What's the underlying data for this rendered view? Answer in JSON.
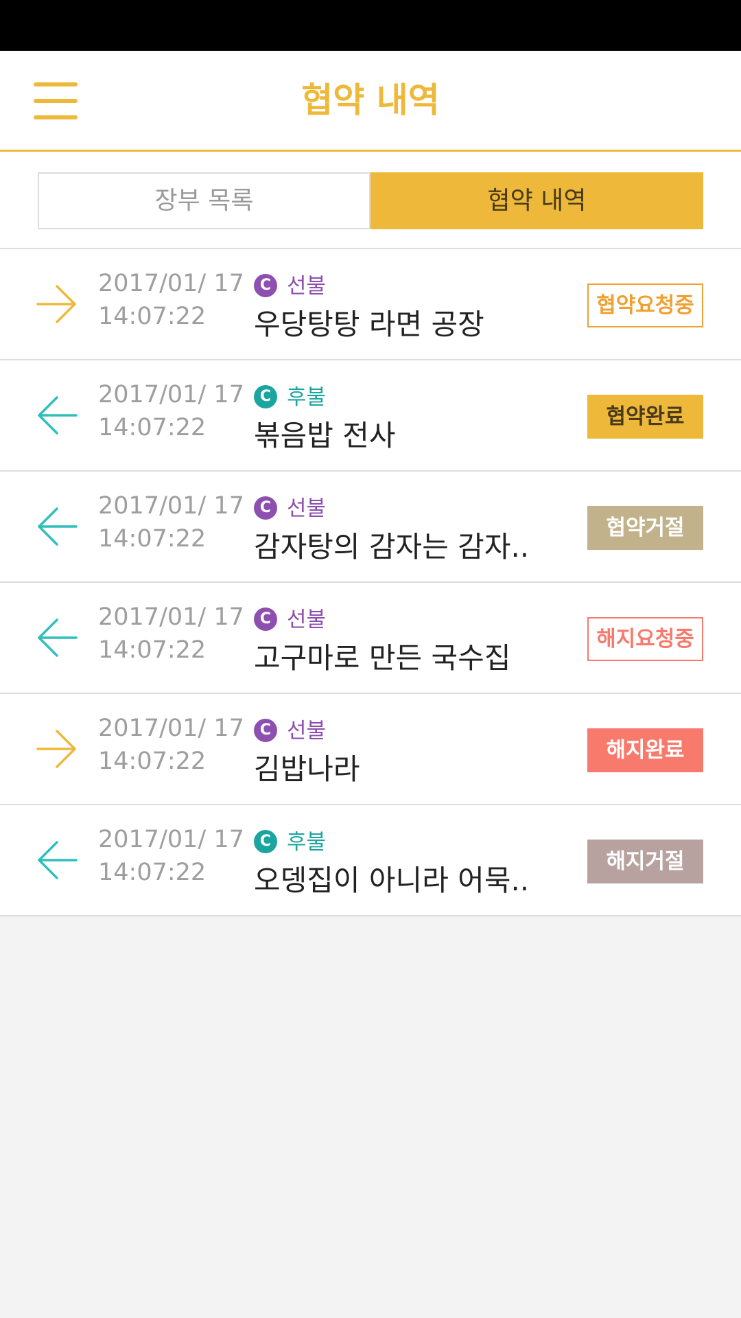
{
  "colors": {
    "accent": "#eeb93a",
    "prepaid": "#8d4fb0",
    "postpaid": "#1aa5a0",
    "outgoing_arrow": "#eeb93a",
    "incoming_arrow": "#2ebfbd"
  },
  "header": {
    "title": "협약 내역",
    "menu_icon": "hamburger-menu-icon"
  },
  "tabs": [
    {
      "label": "장부 목록",
      "active": false
    },
    {
      "label": "협약 내역",
      "active": true
    }
  ],
  "contracts": [
    {
      "direction": "outgoing",
      "icon": "arrow-right-icon",
      "date": "2017/01/ 17",
      "time": "14:07:22",
      "payment_type": "prepaid",
      "pay_badge": "C",
      "payment_label": "선불",
      "name": "우당탕탕 라면 공장",
      "status": "협약요청중",
      "status_style": {
        "bg": "#ffffff",
        "border": "#f0a030",
        "color": "#f0a030"
      }
    },
    {
      "direction": "incoming",
      "icon": "arrow-left-icon",
      "date": "2017/01/ 17",
      "time": "14:07:22",
      "payment_type": "postpaid",
      "pay_badge": "C",
      "payment_label": "후불",
      "name": "볶음밥 전사",
      "status": "협약완료",
      "status_style": {
        "bg": "#eeb93a",
        "border": "#eeb93a",
        "color": "#4a3a1a"
      }
    },
    {
      "direction": "incoming",
      "icon": "arrow-left-icon",
      "date": "2017/01/ 17",
      "time": "14:07:22",
      "payment_type": "prepaid",
      "pay_badge": "C",
      "payment_label": "선불",
      "name": "감자탕의 감자는 감자..",
      "status": "협약거절",
      "status_style": {
        "bg": "#c2b28c",
        "border": "#c2b28c",
        "color": "#ffffff"
      }
    },
    {
      "direction": "incoming",
      "icon": "arrow-left-icon",
      "date": "2017/01/ 17",
      "time": "14:07:22",
      "payment_type": "prepaid",
      "pay_badge": "C",
      "payment_label": "선불",
      "name": "고구마로 만든 국수집",
      "status": "해지요청중",
      "status_style": {
        "bg": "#ffffff",
        "border": "#f87a6c",
        "color": "#f87a6c"
      }
    },
    {
      "direction": "outgoing",
      "icon": "arrow-right-icon",
      "date": "2017/01/ 17",
      "time": "14:07:22",
      "payment_type": "prepaid",
      "pay_badge": "C",
      "payment_label": "선불",
      "name": "김밥나라",
      "status": "해지완료",
      "status_style": {
        "bg": "#f87a6c",
        "border": "#f87a6c",
        "color": "#ffffff"
      }
    },
    {
      "direction": "incoming",
      "icon": "arrow-left-icon",
      "date": "2017/01/ 17",
      "time": "14:07:22",
      "payment_type": "postpaid",
      "pay_badge": "C",
      "payment_label": "후불",
      "name": "오뎅집이 아니라 어묵..",
      "status": "해지거절",
      "status_style": {
        "bg": "#b8a2a0",
        "border": "#b8a2a0",
        "color": "#ffffff"
      }
    }
  ]
}
